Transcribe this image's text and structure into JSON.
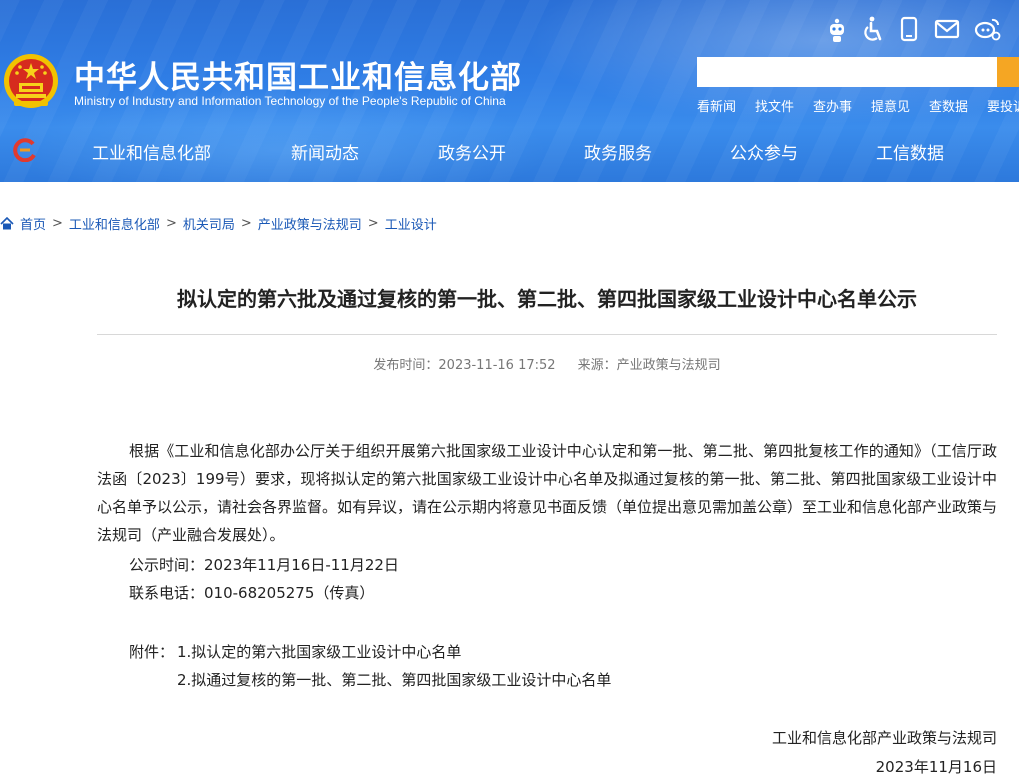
{
  "site": {
    "title": "中华人民共和国工业和信息化部",
    "subtitle": "Ministry of Industry and Information Technology of the People's Republic of China"
  },
  "toolbar": {
    "icons": [
      "robot-icon",
      "accessibility-icon",
      "mobile-icon",
      "mail-icon",
      "weibo-wechat-icon"
    ]
  },
  "search": {
    "value": "",
    "placeholder": ""
  },
  "quick_links": [
    "看新闻",
    "找文件",
    "查办事",
    "提意见",
    "查数据",
    "要投诉"
  ],
  "nav": [
    "工业和信息化部",
    "新闻动态",
    "政务公开",
    "政务服务",
    "公众参与",
    "工信数据"
  ],
  "breadcrumb": [
    "首页",
    "工业和信息化部",
    "机关司局",
    "产业政策与法规司",
    "工业设计"
  ],
  "article": {
    "title": "拟认定的第六批及通过复核的第一批、第二批、第四批国家级工业设计中心名单公示",
    "publish_label": "发布时间：",
    "publish_time": "2023-11-16 17:52",
    "source_label": "来源：",
    "source": "产业政策与法规司",
    "body": "根据《工业和信息化部办公厅关于组织开展第六批国家级工业设计中心认定和第一批、第二批、第四批复核工作的通知》（工信厅政法函〔2023〕199号）要求，现将拟认定的第六批国家级工业设计中心名单及拟通过复核的第一批、第二批、第四批国家级工业设计中心名单予以公示，请社会各界监督。如有异议，请在公示期内将意见书面反馈（单位提出意见需加盖公章）至工业和信息化部产业政策与法规司（产业融合发展处）。",
    "notice_period": "公示时间：2023年11月16日-11月22日",
    "contact": "联系电话：010-68205275（传真）",
    "attachment_label": "附件：",
    "attachments": [
      "1.拟认定的第六批国家级工业设计中心名单",
      "2.拟通过复核的第一批、第二批、第四批国家级工业设计中心名单"
    ],
    "signature": "工业和信息化部产业政策与法规司",
    "date": "2023年11月16日"
  },
  "colors": {
    "header_blue": "#2f7ee6",
    "link": "#1a58b6",
    "search_button": "#f5a623"
  }
}
